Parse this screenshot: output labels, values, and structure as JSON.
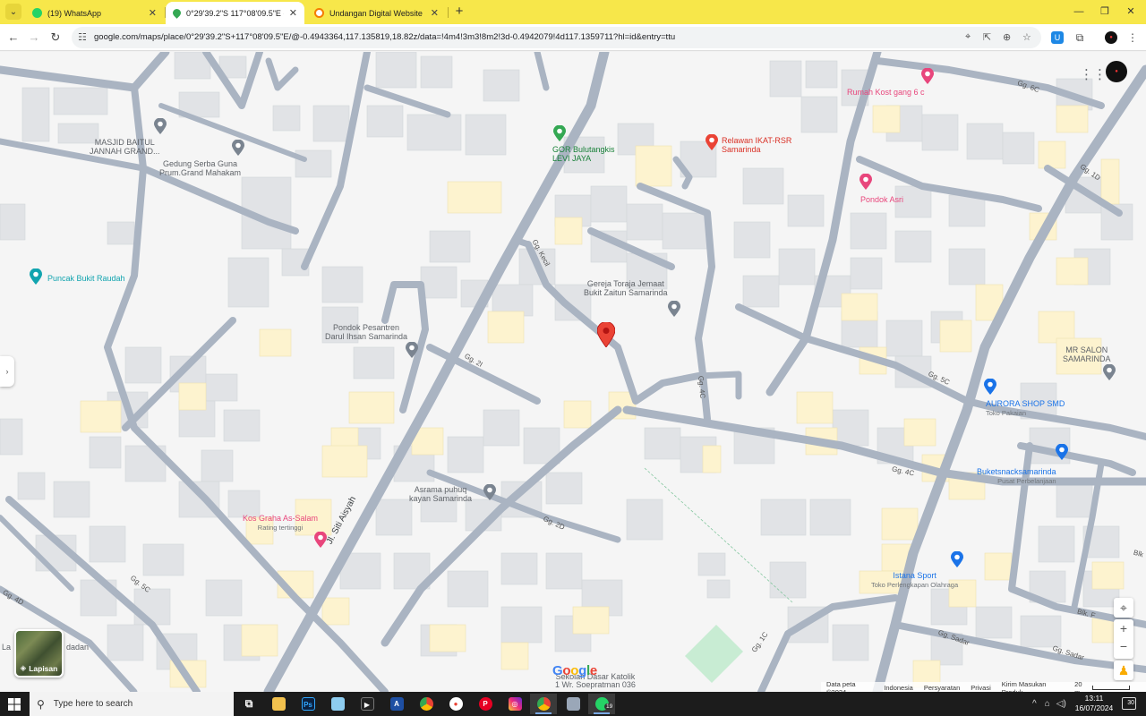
{
  "browser": {
    "tabs": [
      {
        "label": "(19) WhatsApp",
        "favicon_color": "#25d366"
      },
      {
        "label": "0°29'39.2\"S 117°08'09.5\"E - Goo",
        "favicon_color": "#34a853"
      },
      {
        "label": "Undangan Digital Website Prem",
        "favicon_color": "#f57c00"
      }
    ],
    "new_tab": "+",
    "url": "google.com/maps/place/0°29'39.2\"S+117°08'09.5\"E/@-0.4943364,117.135819,18.82z/data=!4m4!3m3!8m2!3d-0.4942079!4d117.1359711?hl=id&entry=ttu"
  },
  "map": {
    "pois": {
      "masjid": "MASJID BAITUL\nJANNAH GRAND...",
      "gedung": "Gedung Serba Guna\nPrum.Grand Mahakam",
      "puncak": "Puncak Bukit Raudah",
      "gor": "GOR Bulutangkis\nLEVI JAYA",
      "relawan": "Relawan IKAT-RSR\nSamarinda",
      "rumah_kost": "Rumah Kost gang 6 c",
      "pondok_asri": "Pondok Asri",
      "gereja": "Gereja Toraja Jemaat\nBukit Zaitun Samarinda",
      "pesantren": "Pondok Pesantren\nDarul Ihsan Samarinda",
      "mr_salon": "MR SALON\nSAMARINDA",
      "aurora": "AURORA SHOP SMD",
      "aurora_sub": "Toko Pakaian",
      "buketsnack": "Buketsnacksamarinda",
      "buketsnack_sub": "Pusat Perbelanjaan",
      "asrama": "Asrama puhuq\nkayan Samarinda",
      "kos_graha": "Kos Graha As-Salam",
      "kos_graha_sub": "Rating tertinggi",
      "istana": "Istana Sport",
      "istana_sub": "Toko Perlengkapan Olahraga",
      "sekolah": "Sekolah Dasar Katolik\n1 Wr. Soepratman 036",
      "lapisan_partial": "La",
      "dadan_partial": "dadan"
    },
    "streets": {
      "gg6c": "Gg. 6C",
      "gg1d": "Gg. 1D",
      "gg_kecil": "Gg. Kecil",
      "gg2i": "Gg. 2I",
      "gg4c_v": "Gg. 4C",
      "gg5c_right": "Gg. 5C",
      "gg4c": "Gg. 4C",
      "jl_siti": "Jl. Siti Aisyah",
      "gg2d": "Gg. 2D",
      "gg5c_left": "Gg. 5C",
      "gg4d": "Gg. 4D",
      "gg1c": "Gg. 1C",
      "gg_sadar": "Gg. Sadar",
      "gg_sadar2": "Gg. Sadar",
      "blk_f": "Blk. F",
      "blk_partial": "Blk"
    },
    "layers_label": "Lapisan",
    "google": "Google",
    "footer": {
      "data": "Data peta ©2024",
      "country": "Indonesia",
      "terms": "Persyaratan",
      "privacy": "Privasi",
      "feedback": "Kirim Masukan Produk",
      "scale": "20 m"
    },
    "colors": {
      "road": "#aab4c2",
      "building": "#e1e3e6",
      "building_yellow": "#fdf3cf",
      "park": "#c8ecd3",
      "pin": "#ea4335"
    }
  },
  "taskbar": {
    "search_placeholder": "Type here to search",
    "whatsapp_badge": "19",
    "time": "13:11",
    "date": "16/07/2024",
    "notifications": "30"
  }
}
